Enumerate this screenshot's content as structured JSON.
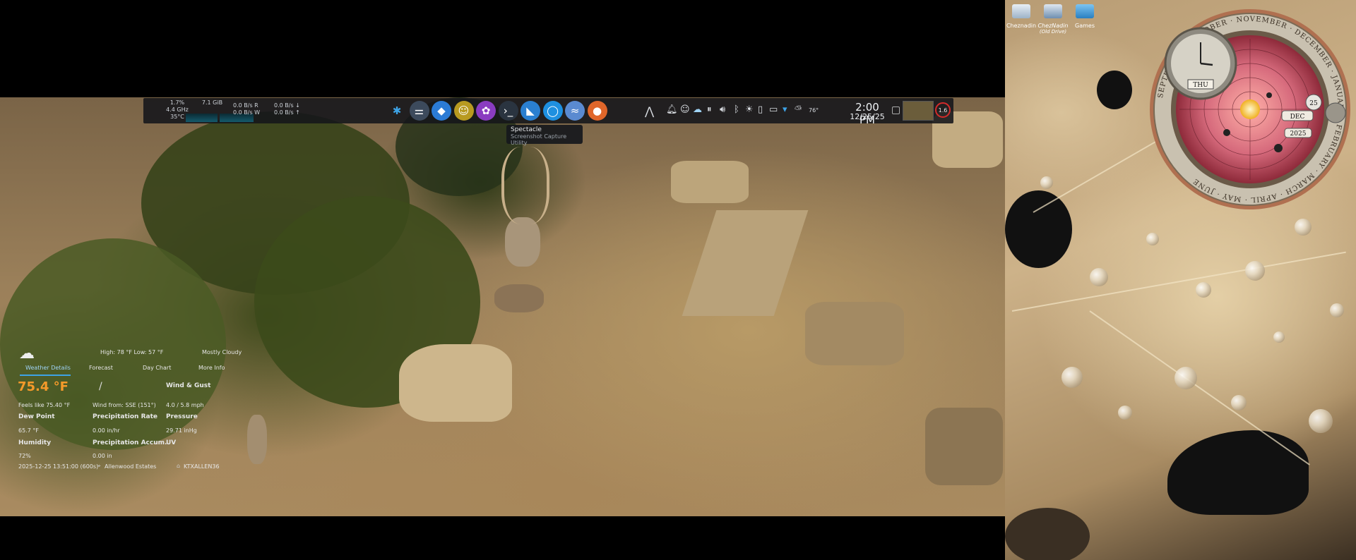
{
  "panel": {
    "cpu": {
      "usage": "1.7%",
      "freq": "4.4 GHz",
      "temp": "35°C"
    },
    "memory": {
      "used": "7.1 GiB"
    },
    "disk": {
      "read": "0.0 B/s R",
      "write": "0.0 B/s W"
    },
    "network": {
      "down": "0.0 B/s ↓",
      "up": "0.0 B/s ↑"
    },
    "launchers": [
      {
        "name": "kde-icon",
        "glyph": "✱"
      },
      {
        "name": "system-settings-icon",
        "glyph": "⚌"
      },
      {
        "name": "discover-icon",
        "glyph": "◆"
      },
      {
        "name": "smiley-app-icon",
        "glyph": "☺"
      },
      {
        "name": "purple-app-icon",
        "glyph": "✿"
      },
      {
        "name": "terminal-icon",
        "glyph": "›_"
      },
      {
        "name": "spectacle-icon",
        "glyph": "◣"
      },
      {
        "name": "blue-circle-app-icon",
        "glyph": "◯"
      },
      {
        "name": "blue-wave-app-icon",
        "glyph": "≈"
      },
      {
        "name": "firefox-icon",
        "glyph": "●"
      }
    ],
    "tray": {
      "weather_temp": "76°",
      "clock_time": "2:00 PM",
      "clock_date": "12/25/25",
      "badge": "1.6"
    }
  },
  "tooltip": {
    "title": "Spectacle",
    "subtitle": "Screenshot Capture Utility"
  },
  "weather": {
    "tabs": [
      "Weather Details",
      "Forecast",
      "Day Chart",
      "More Info"
    ],
    "high_low": "High: 78 °F Low: 57 °F",
    "condition": "Mostly Cloudy",
    "temperature": "75.4 °F",
    "feels_like": "Feels like 75.40 °F",
    "wind_from": "Wind from: SSE (151°)",
    "wind_gust_label": "Wind & Gust",
    "wind_gust_value": "4.0 / 5.8 mph",
    "dew_point_label": "Dew Point",
    "dew_point_value": "65.7 °F",
    "precip_rate_label": "Precipitation Rate",
    "precip_rate_value": "0.00 in/hr",
    "pressure_label": "Pressure",
    "pressure_value": "29.71 inHg",
    "humidity_label": "Humidity",
    "humidity_value": "72%",
    "precip_accum_label": "Precipitation Accum.",
    "precip_accum_value": "0.00 in",
    "uv_label": "UV",
    "updated": "2025-12-25 13:51:00 (600s)",
    "location": "Allenwood Estates",
    "station": "KTXALLEN36"
  },
  "desktop_icons": [
    {
      "label": "Cheznadin",
      "sub": ""
    },
    {
      "label": "ChezNadin",
      "sub": "(Old Drive)"
    },
    {
      "label": "Games",
      "sub": ""
    }
  ],
  "orrery": {
    "months": [
      "SEPTEMBER",
      "OCTOBER",
      "NOVEMBER",
      "DECEMBER",
      "JANUARY",
      "FEBRUARY",
      "MARCH",
      "APRIL",
      "MAY",
      "JUNE"
    ],
    "weekday": "THU",
    "month": "DEC",
    "day": "25",
    "year": "2025"
  },
  "colors": {
    "accent": "#3da3e6",
    "temp_orange": "#f59a2a",
    "badge_ring": "#d42b2b",
    "panel_bg": "#16181c"
  }
}
